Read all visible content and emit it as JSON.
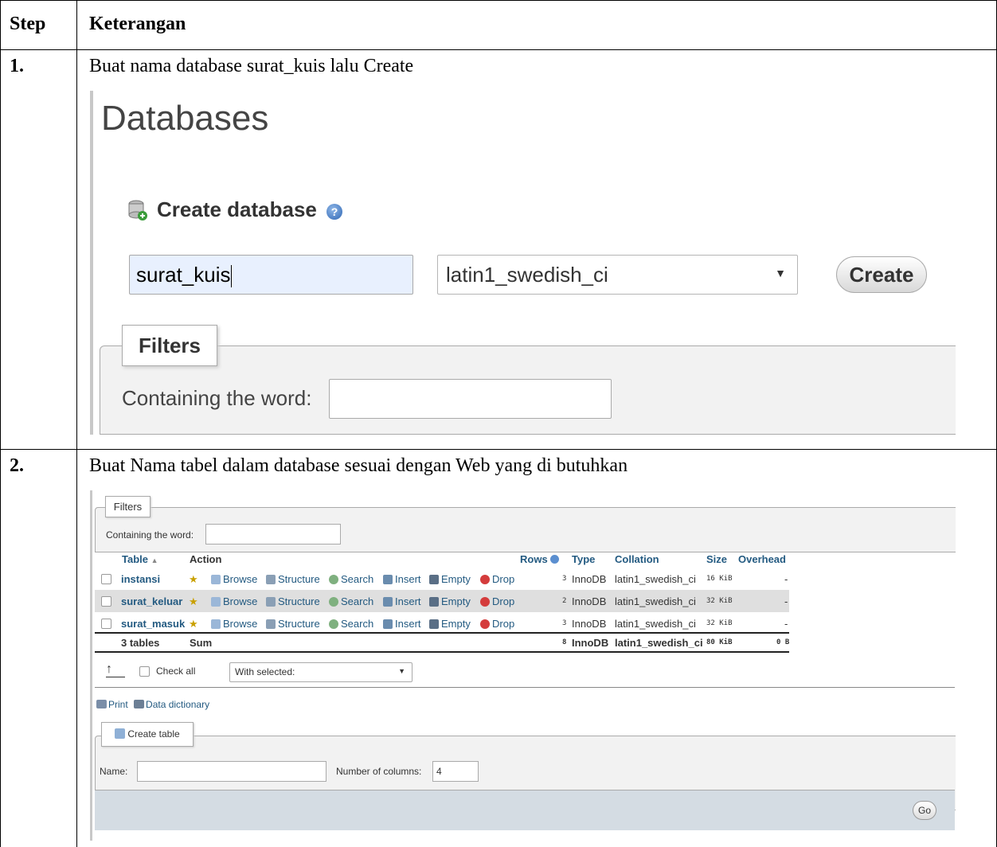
{
  "table": {
    "header": {
      "step": "Step",
      "desc": "Keterangan"
    },
    "rows": [
      {
        "step": "1.",
        "desc": "Buat nama database surat_kuis lalu Create"
      },
      {
        "step": "2.",
        "desc": "Buat Nama tabel dalam database sesuai dengan Web yang di butuhkan"
      }
    ]
  },
  "shot1": {
    "heading": "Databases",
    "create_db_label": "Create database",
    "db_name_value": "surat_kuis",
    "collation_value": "latin1_swedish_ci",
    "create_button": "Create",
    "filters_legend": "Filters",
    "containing_label": "Containing the word:"
  },
  "shot2": {
    "filters_legend": "Filters",
    "containing_label": "Containing the word:",
    "columns": {
      "table": "Table",
      "action": "Action",
      "rows": "Rows",
      "type": "Type",
      "collation": "Collation",
      "size": "Size",
      "overhead": "Overhead"
    },
    "actions": {
      "browse": "Browse",
      "structure": "Structure",
      "search": "Search",
      "insert": "Insert",
      "empty": "Empty",
      "drop": "Drop"
    },
    "tables": [
      {
        "name": "instansi",
        "rows": "3",
        "type": "InnoDB",
        "collation": "latin1_swedish_ci",
        "size": "16 KiB",
        "overhead": "-"
      },
      {
        "name": "surat_keluar",
        "rows": "2",
        "type": "InnoDB",
        "collation": "latin1_swedish_ci",
        "size": "32 KiB",
        "overhead": "-"
      },
      {
        "name": "surat_masuk",
        "rows": "3",
        "type": "InnoDB",
        "collation": "latin1_swedish_ci",
        "size": "32 KiB",
        "overhead": "-"
      }
    ],
    "summary": {
      "count": "3 tables",
      "label": "Sum",
      "rows": "8",
      "type": "InnoDB",
      "collation": "latin1_swedish_ci",
      "size": "80 KiB",
      "overhead": "0 B"
    },
    "check_all": "Check all",
    "with_selected": "With selected:",
    "print": "Print",
    "data_dictionary": "Data dictionary",
    "create_table_legend": "Create table",
    "name_label": "Name:",
    "num_columns_label": "Number of columns:",
    "num_columns_value": "4",
    "go_button": "Go"
  }
}
